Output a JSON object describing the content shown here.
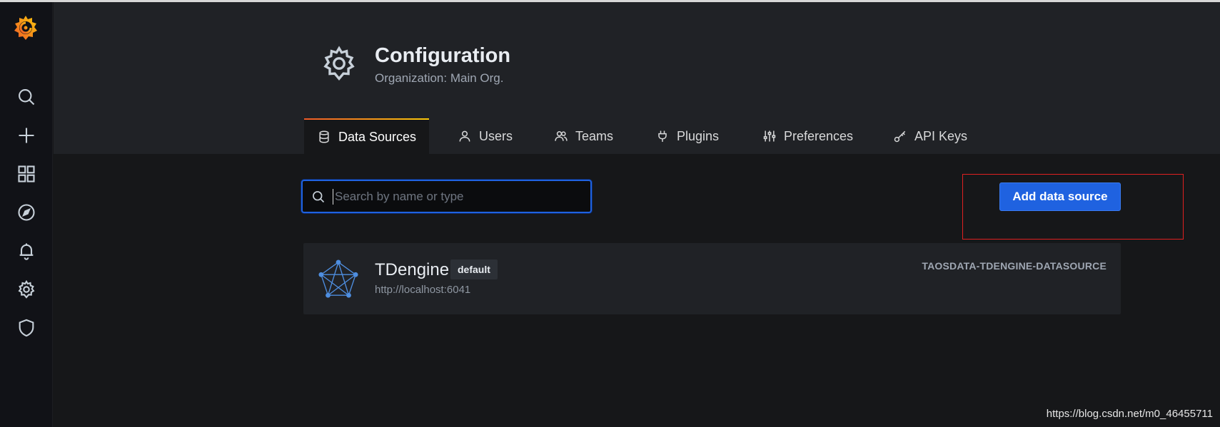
{
  "header": {
    "title": "Configuration",
    "subtitle": "Organization: Main Org."
  },
  "tabs": [
    {
      "label": "Data Sources",
      "icon": "database-icon",
      "active": true
    },
    {
      "label": "Users",
      "icon": "user-icon",
      "active": false
    },
    {
      "label": "Teams",
      "icon": "users-icon",
      "active": false
    },
    {
      "label": "Plugins",
      "icon": "plug-icon",
      "active": false
    },
    {
      "label": "Preferences",
      "icon": "sliders-icon",
      "active": false
    },
    {
      "label": "API Keys",
      "icon": "key-icon",
      "active": false
    }
  ],
  "sidebar": {
    "items": [
      {
        "icon": "search-icon"
      },
      {
        "icon": "plus-icon"
      },
      {
        "icon": "dashboards-icon"
      },
      {
        "icon": "compass-icon"
      },
      {
        "icon": "bell-icon"
      },
      {
        "icon": "gear-icon"
      },
      {
        "icon": "shield-icon"
      }
    ]
  },
  "search": {
    "placeholder": "Search by name or type",
    "value": ""
  },
  "actions": {
    "add_label": "Add data source"
  },
  "datasources": [
    {
      "name": "TDengine",
      "badge": "default",
      "url": "http://localhost:6041",
      "type": "TAOSDATA-TDENGINE-DATASOURCE"
    }
  ],
  "watermark": "https://blog.csdn.net/m0_46455711",
  "colors": {
    "accent": "#1f62e0",
    "highlight": "#e02020",
    "background": "#161719",
    "panel": "#202226"
  }
}
